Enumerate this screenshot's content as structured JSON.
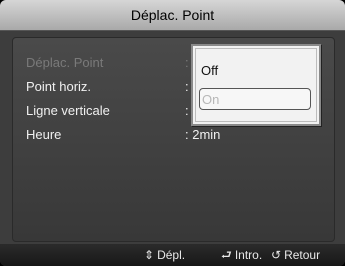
{
  "title": "Déplac. Point",
  "menu": {
    "items": [
      {
        "label": "Déplac. Point",
        "value": ":"
      },
      {
        "label": "Point horiz.",
        "value": ":"
      },
      {
        "label": "Ligne verticale",
        "value": ":"
      },
      {
        "label": "Heure",
        "value": ": 2min"
      }
    ]
  },
  "popup": {
    "options": [
      {
        "label": "Off"
      },
      {
        "label": "On"
      }
    ]
  },
  "footer": {
    "move_icon": "⇕",
    "move_label": "Dépl.",
    "enter_icon": "⮐",
    "enter_label": "Intro.",
    "return_icon": "↺",
    "return_label": "Retour"
  }
}
